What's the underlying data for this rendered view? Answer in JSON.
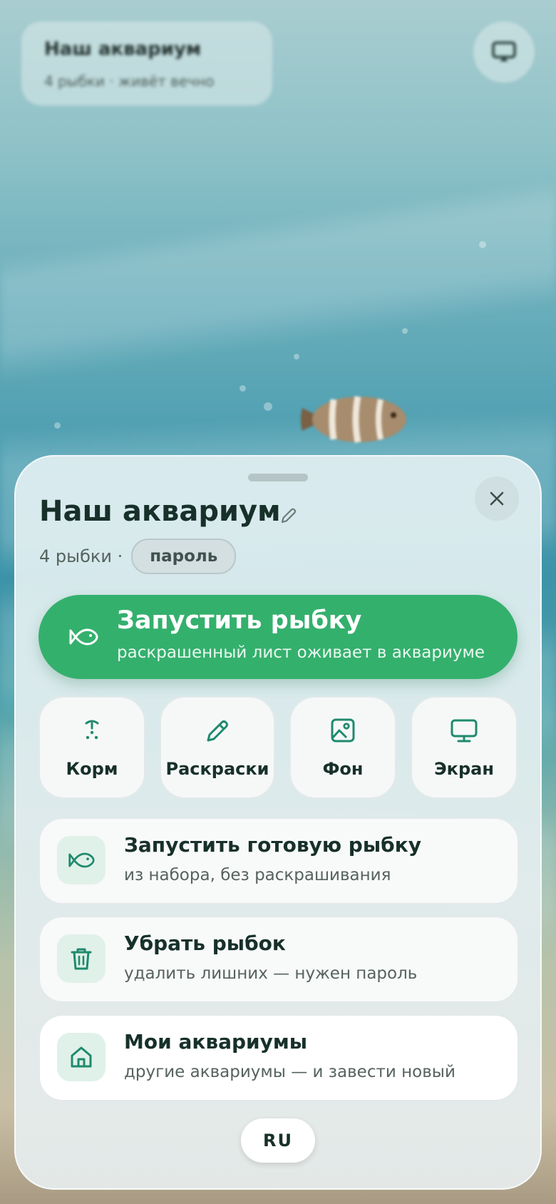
{
  "background": {
    "header": {
      "title": "Наш аквариум",
      "subtitle": "4 рыбки · живёт вечно"
    }
  },
  "sheet": {
    "title": "Наш аквариум",
    "fish_count": "4 рыбки ·",
    "password_badge": "пароль",
    "launch": {
      "title": "Запустить рыбку",
      "subtitle": "раскрашенный лист оживает в аквариуме"
    },
    "tiles": [
      {
        "label": "Корм",
        "icon": "food-icon"
      },
      {
        "label": "Раскраски",
        "icon": "pencil-icon"
      },
      {
        "label": "Фон",
        "icon": "image-icon"
      },
      {
        "label": "Экран",
        "icon": "monitor-icon"
      }
    ],
    "rows": [
      {
        "title": "Запустить готовую рыбку",
        "subtitle": "из набора, без раскрашивания",
        "icon": "fish-icon"
      },
      {
        "title": "Убрать рыбок",
        "subtitle": "удалить лишних — нужен пароль",
        "icon": "trash-icon"
      },
      {
        "title": "Мои аквариумы",
        "subtitle": "другие аквариумы — и завести новый",
        "icon": "home-icon"
      }
    ],
    "language": "RU"
  },
  "colors": {
    "accent": "#34b06d",
    "icon": "#1f8a6d",
    "text": "#17302a"
  }
}
